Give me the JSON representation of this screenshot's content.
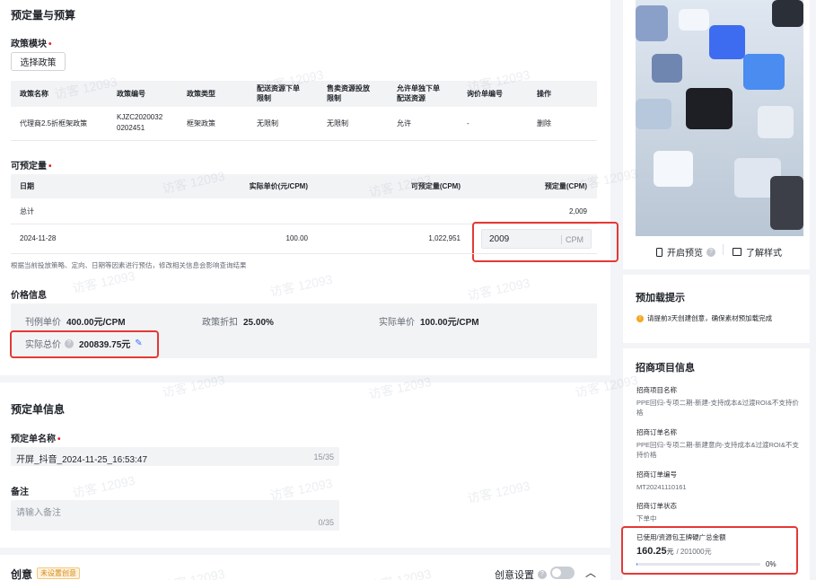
{
  "section_reserve": {
    "title": "预定量与预算",
    "policy_module_label": "政策模块",
    "select_policy_button": "选择政策",
    "policy_table": {
      "headers": [
        "政策名称",
        "政策编号",
        "政策类型",
        "配送资源下单\n限制",
        "售卖资源投放\n限制",
        "允许单独下单\n配送资源",
        "询价单编号",
        "操作"
      ],
      "row": [
        "代理商2.5折框架政策",
        "KJZC2020032\n0202451",
        "框架政策",
        "无限制",
        "无限制",
        "允许",
        "-",
        "删除"
      ]
    },
    "reservable_label": "可预定量",
    "reserve_table": {
      "headers": [
        "日期",
        "实际单价(元/CPM)",
        "可预定量(CPM)",
        "预定量(CPM)"
      ],
      "total_label": "总计",
      "total_value": "2,009",
      "row": {
        "date": "2024-11-28",
        "unit_price": "100.00",
        "available": "1,022,951",
        "input_value": "2009",
        "input_unit": "CPM"
      }
    },
    "hint": "根据当前投放策略、定向、日期等因素进行预估，修改相关信息会影响查询结果",
    "price_label": "价格信息",
    "price": {
      "list_price_label": "刊例单价",
      "list_price": "400.00元/CPM",
      "discount_label": "政策折扣",
      "discount": "25.00%",
      "actual_unit_label": "实际单价",
      "actual_unit": "100.00元/CPM",
      "total_label": "实际总价",
      "total": "200839.75元"
    }
  },
  "section_order": {
    "title": "预定单信息",
    "name_label": "预定单名称",
    "name_value": "开屏_抖音_2024-11-25_16:53:47",
    "name_counter": "15/35",
    "note_label": "备注",
    "note_placeholder": "请输入备注",
    "note_counter": "0/35"
  },
  "section_creative": {
    "title": "创意",
    "tag": "未设置创意",
    "setting_label": "创意设置"
  },
  "sidebar": {
    "preview_button": "开启预览",
    "style_button": "了解样式",
    "preload_title": "预加载提示",
    "preload_text": "请提前3天创建创意，确保素材预加载完成",
    "merchant_title": "招商项目信息",
    "project_name_label": "招商项目名称",
    "project_name": "PPE回归-专项二期-新建-支持成本&过渡ROI&不支持价格",
    "order_name_label": "招商订单名称",
    "order_name": "PPE回归-专项二期-新建意向-支持成本&过渡ROI&不支持价格",
    "order_no_label": "招商订单编号",
    "order_no": "MT20241110161",
    "order_status_label": "招商订单状态",
    "order_status": "下单中",
    "used_label": "已使用/资源包王牌硬广总金额",
    "used_amount": "160.25",
    "used_unit": "元",
    "total_amount": "/ 201000元",
    "percent": "0%",
    "progress_fraction": 0.0008
  },
  "watermark": "访客 12093",
  "colors": {
    "accent": "#3370ff",
    "danger": "#e53935",
    "warning": "#f5a623"
  }
}
